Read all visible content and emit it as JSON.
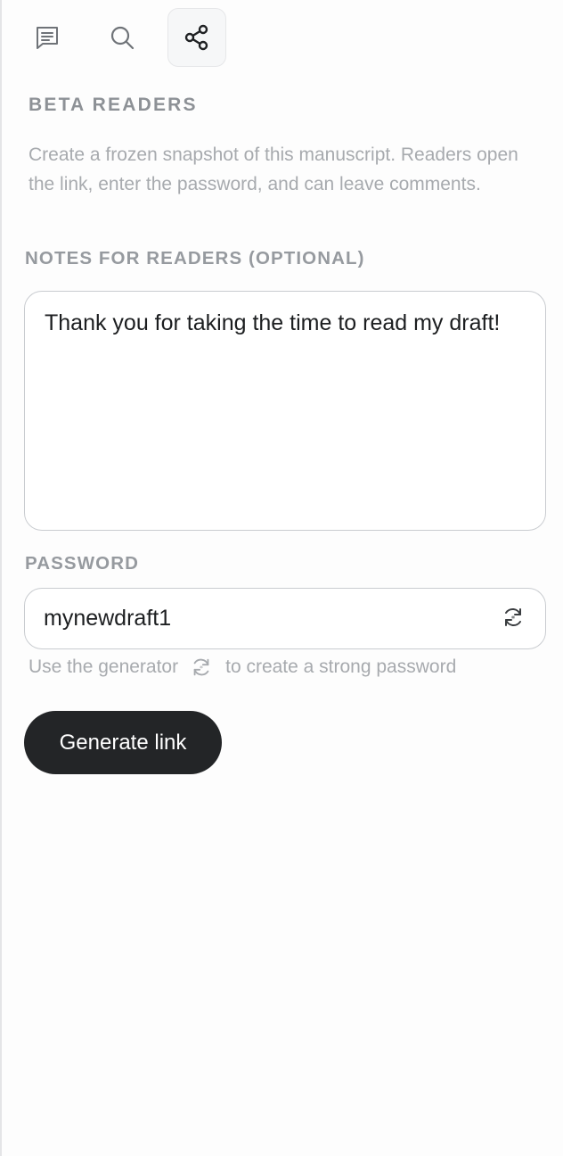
{
  "toolbar": {
    "items": [
      {
        "icon": "comments-icon",
        "active": false
      },
      {
        "icon": "search-icon",
        "active": false
      },
      {
        "icon": "share-icon",
        "active": true
      }
    ]
  },
  "beta_readers": {
    "title": "BETA READERS",
    "description": "Create a frozen snapshot of this manuscript. Readers open the link, enter the password, and can leave comments."
  },
  "notes": {
    "label": "NOTES FOR READERS (OPTIONAL)",
    "value": "Thank you for taking the time to read my draft!"
  },
  "password": {
    "label": "PASSWORD",
    "value": "mynewdraft1",
    "hint_before": "Use the generator",
    "hint_after": "to create a strong password",
    "regenerate_icon": "refresh-icon"
  },
  "generate": {
    "label": "Generate link"
  },
  "colors": {
    "button_bg": "#232527",
    "muted_text": "#a7aaae",
    "label_text": "#969a9f",
    "border": "#c9ccd0"
  }
}
